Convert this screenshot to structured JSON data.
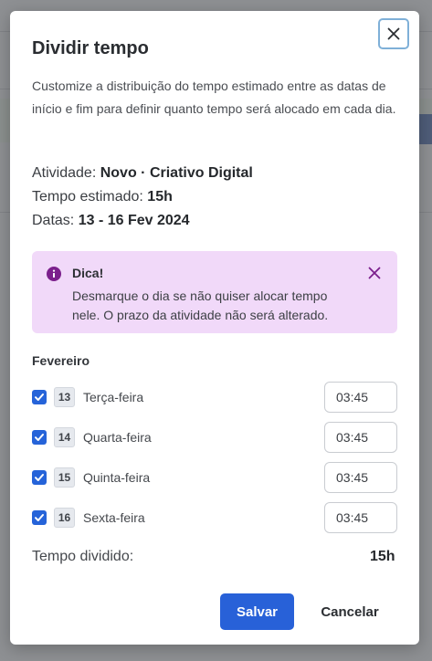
{
  "modal": {
    "title": "Dividir tempo",
    "description": "Customize a distribuição do tempo estimado entre as datas de início e fim para definir quanto tempo será alocado em cada dia.",
    "activity_label": "Atividade:",
    "activity_value": "Novo · Criativo Digital",
    "estimate_label": "Tempo estimado:",
    "estimate_value": "15h",
    "dates_label": "Datas:",
    "dates_value": "13 - 16 Fev 2024"
  },
  "tip": {
    "title": "Dica!",
    "text": "Desmarque o dia se não quiser alocar tempo nele. O prazo da atividade não será alterado.",
    "icon": "info-icon"
  },
  "schedule": {
    "month": "Fevereiro",
    "days": [
      {
        "num": "13",
        "name": "Terça-feira",
        "time": "03:45",
        "checked": true
      },
      {
        "num": "14",
        "name": "Quarta-feira",
        "time": "03:45",
        "checked": true
      },
      {
        "num": "15",
        "name": "Quinta-feira",
        "time": "03:45",
        "checked": true
      },
      {
        "num": "16",
        "name": "Sexta-feira",
        "time": "03:45",
        "checked": true
      }
    ],
    "total_label": "Tempo dividido:",
    "total_value": "15h"
  },
  "actions": {
    "save_label": "Salvar",
    "cancel_label": "Cancelar"
  },
  "colors": {
    "primary": "#2861d8",
    "tip_background": "#f1d9f9",
    "tip_accent": "#7b1f8c"
  }
}
